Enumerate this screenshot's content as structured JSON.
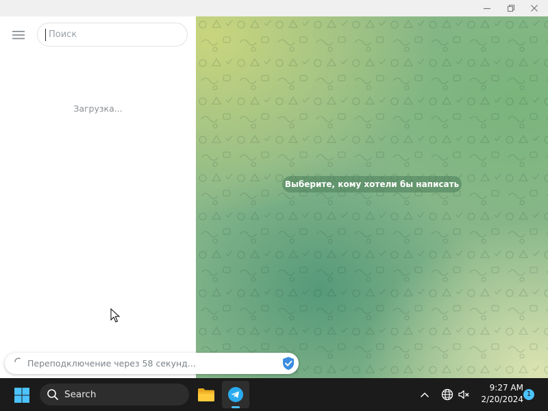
{
  "window": {
    "minimize_icon": "minimize-icon",
    "restore_icon": "restore-icon",
    "close_icon": "close-icon"
  },
  "sidebar": {
    "menu_icon": "hamburger-menu-icon",
    "search_placeholder": "Поиск",
    "search_value": "",
    "loading_text": "Загрузка..."
  },
  "chat": {
    "empty_hint": "Выберите, кому хотели бы написать"
  },
  "connection": {
    "status_text": "Переподключение через 58 секунд...",
    "spinner_icon": "loading-spinner-icon",
    "proxy_icon": "shield-check-icon"
  },
  "taskbar": {
    "start_icon": "windows-start-icon",
    "search_label": "Search",
    "apps": [
      {
        "name": "File Explorer",
        "icon": "folder-icon",
        "active": false
      },
      {
        "name": "Telegram",
        "icon": "telegram-icon",
        "active": true
      }
    ],
    "tray": {
      "chevron_icon": "chevron-up-icon",
      "network_icon": "globe-icon",
      "volume_icon": "volume-muted-icon"
    },
    "time": "9:27 AM",
    "date": "2/20/2024",
    "notification_count": "1"
  },
  "colors": {
    "accent": "#4cc2ff",
    "telegram_blue": "#2aabee",
    "chat_bg": "#88b78a",
    "taskbar_bg": "#1b1b1b"
  }
}
